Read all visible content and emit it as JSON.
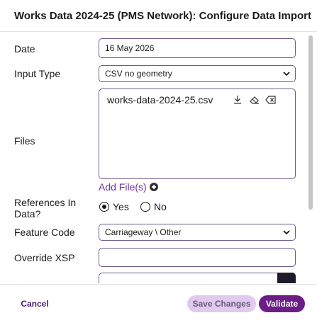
{
  "dialog": {
    "title": "Works Data 2024-25 (PMS Network): Configure Data Import"
  },
  "form": {
    "date": {
      "label": "Date",
      "value": "16 May 2026"
    },
    "input_type": {
      "label": "Input Type",
      "value": "CSV no geometry"
    },
    "files": {
      "label": "Files",
      "items": [
        {
          "name": "works-data-2024-25.csv",
          "icons": [
            "download-icon",
            "eraser-icon",
            "backspace-icon"
          ]
        }
      ],
      "add_label": "Add File(s)"
    },
    "references": {
      "label": "References In Data?",
      "options": [
        {
          "label": "Yes",
          "selected": true
        },
        {
          "label": "No",
          "selected": false
        }
      ]
    },
    "feature_code": {
      "label": "Feature Code",
      "value": "Carriageway \\ Other"
    },
    "override_xsp": {
      "label": "Override XSP",
      "value": ""
    }
  },
  "footer": {
    "cancel_label": "Cancel",
    "save_label": "Save Changes",
    "validate_label": "Validate"
  },
  "colors": {
    "accent": "#6a1e86",
    "accent_light": "#e2c9ef",
    "link": "#6b2fa6",
    "field_border": "#6e5d8e"
  }
}
